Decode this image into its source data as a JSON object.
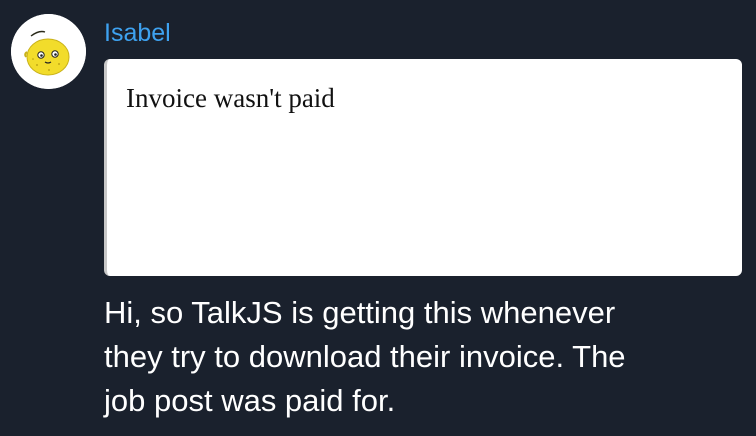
{
  "message": {
    "author": "Isabel",
    "avatar": {
      "icon": "lemon-avatar-icon",
      "background": "#ffffff",
      "fruit_color": "#f2dc2b"
    },
    "attachment": {
      "text": "Invoice wasn't paid"
    },
    "body_lines": [
      "Hi, so TalkJS is getting this whenever",
      "they try to download their invoice. The",
      "job post was paid for."
    ]
  },
  "colors": {
    "background": "#1a212d",
    "author_name": "#3ea2f0",
    "body_text": "#ffffff"
  }
}
